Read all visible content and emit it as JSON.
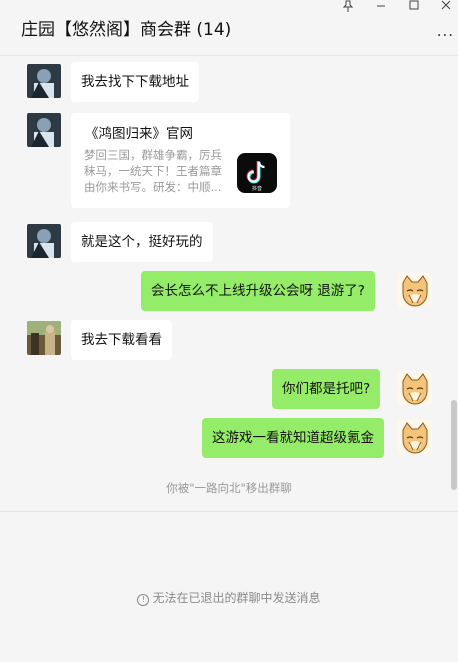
{
  "header": {
    "title": "庄园【悠然阁】商会群 (14)",
    "pin_icon": "pin-icon",
    "minimize_icon": "minimize-icon",
    "maximize_icon": "maximize-icon",
    "close_icon": "close-icon",
    "more_label": "..."
  },
  "messages": [
    {
      "side": "left",
      "text": "我去找下下载地址"
    },
    {
      "side": "left",
      "type": "card",
      "title": "《鸿图归来》官网",
      "desc": "梦回三国，群雄争霸，厉兵秣马，一统天下！王者篇章由你来书写。研发：中顺...",
      "icon": "tiktok-icon",
      "icon_label": "抖音"
    },
    {
      "side": "left",
      "text": "就是这个，挺好玩的"
    },
    {
      "side": "right",
      "text": "会长怎么不上线升级公会呀 退游了?"
    },
    {
      "side": "left",
      "text": "我去下载看看"
    },
    {
      "side": "right",
      "text": "你们都是托吧?"
    },
    {
      "side": "right",
      "text": "这游戏一看就知道超级氪金"
    }
  ],
  "system_message": "你被\"一路向北\"移出群聊",
  "footer": {
    "notice": "无法在已退出的群聊中发送消息",
    "notice_icon": "info-icon"
  },
  "colors": {
    "background": "#f5f5f5",
    "bubble_left": "#ffffff",
    "bubble_right": "#95ec69"
  }
}
